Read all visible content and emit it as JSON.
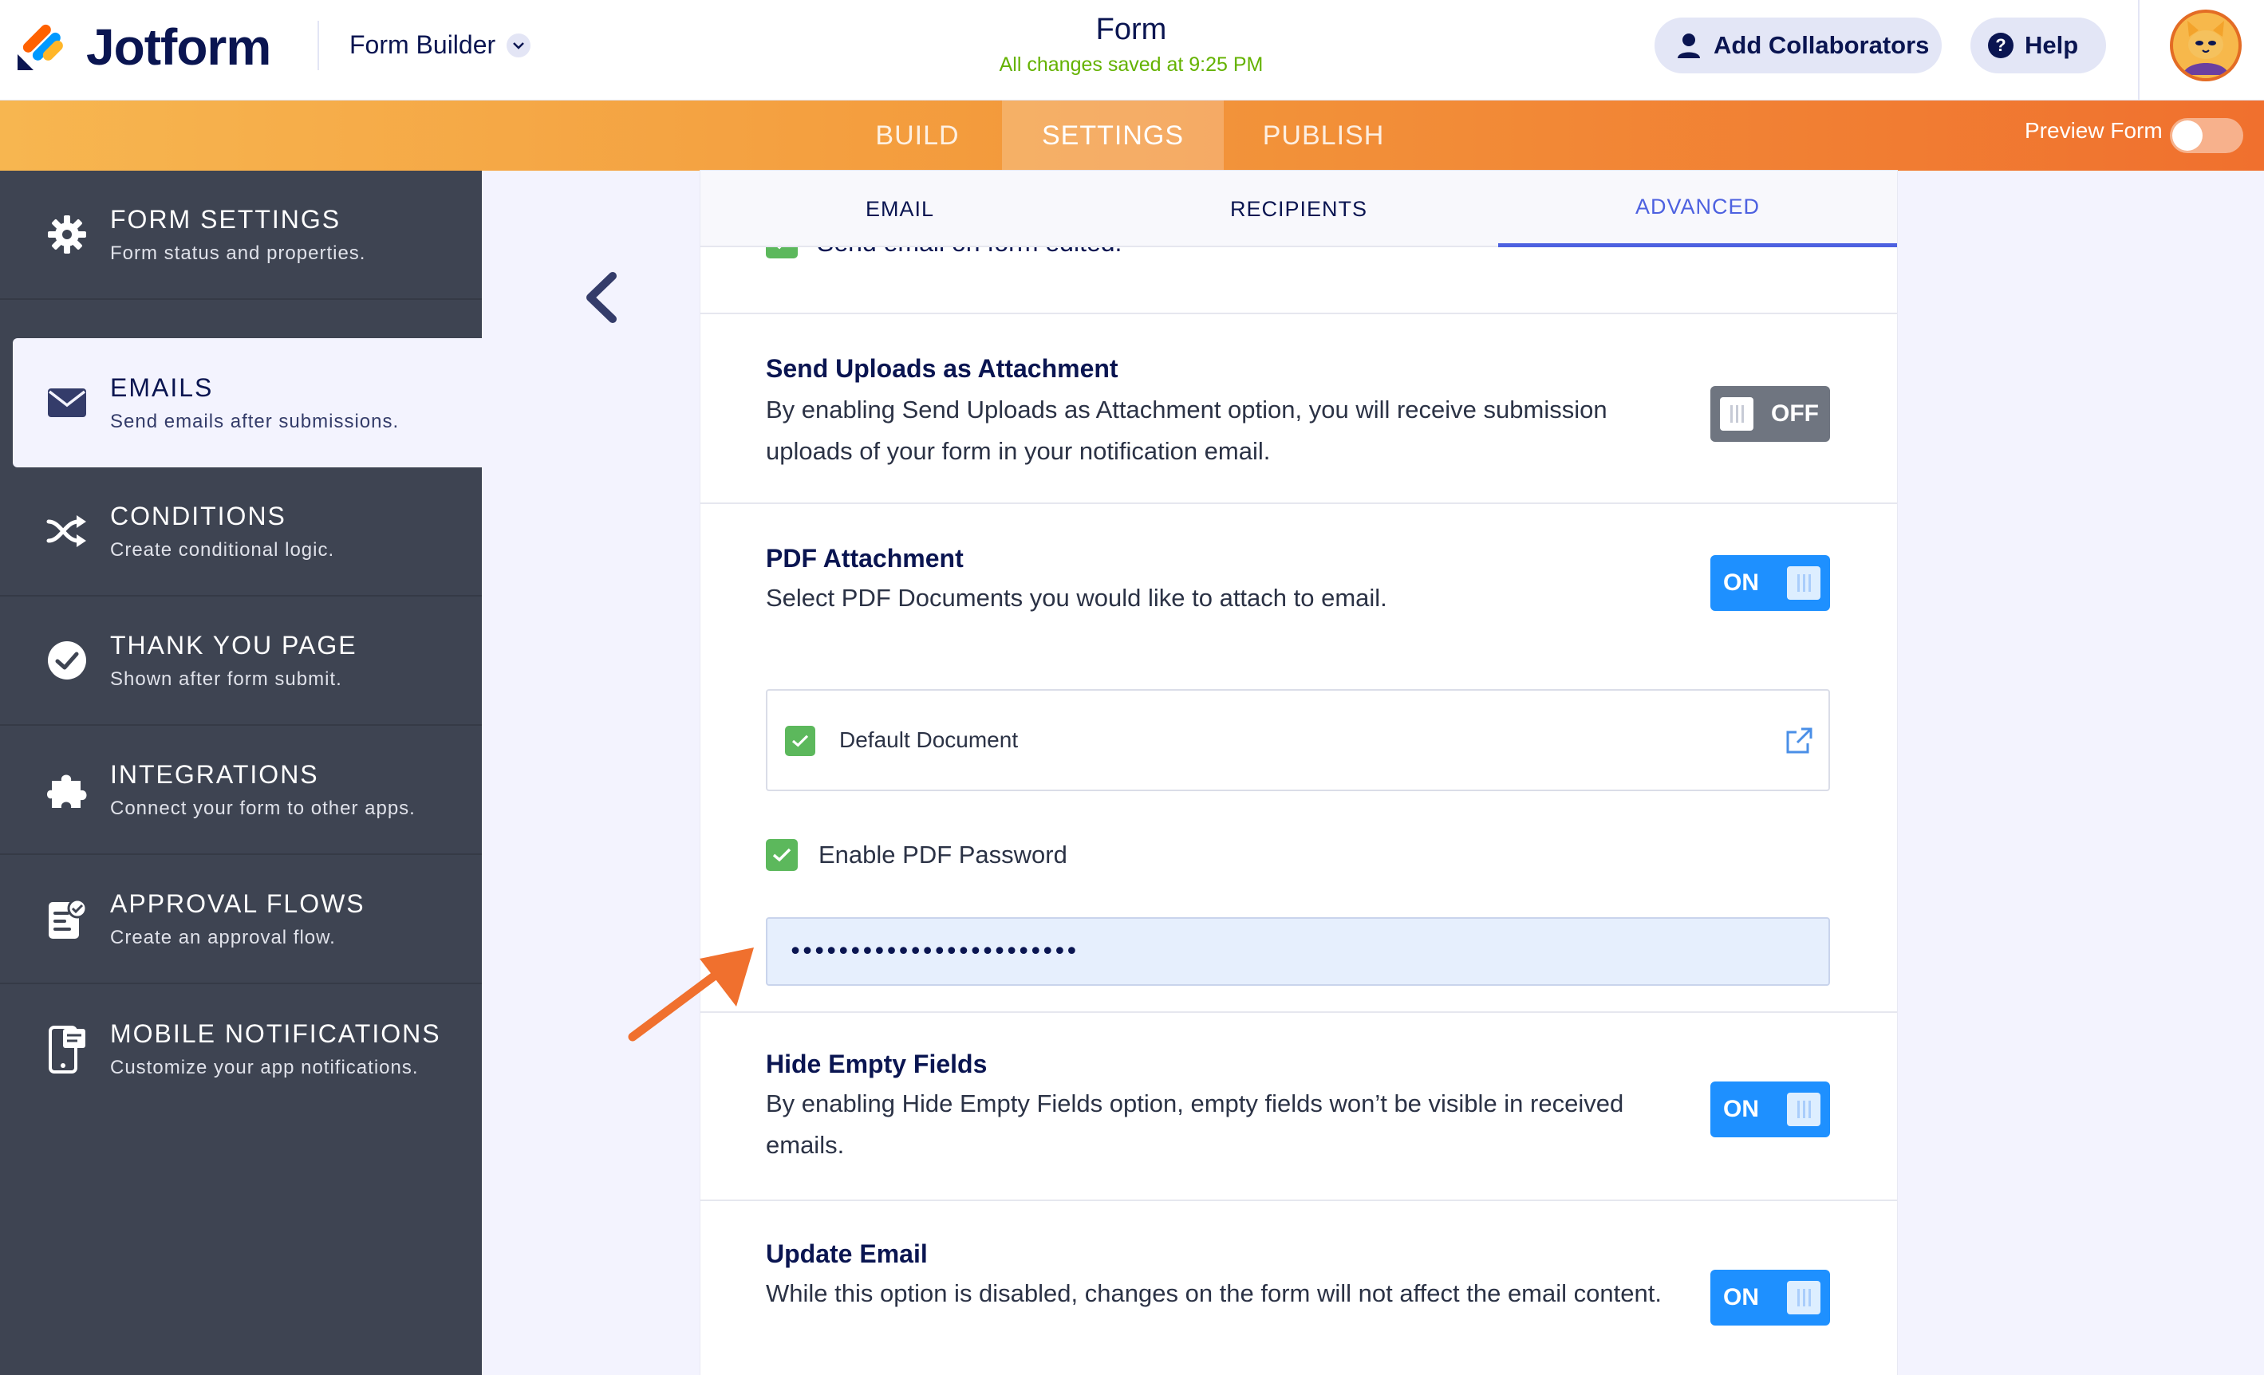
{
  "header": {
    "brand": "Jotform",
    "form_builder_label": "Form Builder",
    "form_title": "Form",
    "save_status": "All changes saved at 9:25 PM",
    "add_collaborators_label": "Add Collaborators",
    "help_label": "Help",
    "help_glyph": "?"
  },
  "nav": {
    "tabs": [
      {
        "label": "BUILD"
      },
      {
        "label": "SETTINGS"
      },
      {
        "label": "PUBLISH"
      }
    ],
    "active": "SETTINGS",
    "preview_label": "Preview Form"
  },
  "sidebar": {
    "items": [
      {
        "title": "FORM SETTINGS",
        "subtitle": "Form status and properties.",
        "icon": "gear-icon"
      },
      {
        "title": "EMAILS",
        "subtitle": "Send emails after submissions.",
        "icon": "envelope-icon"
      },
      {
        "title": "CONDITIONS",
        "subtitle": "Create conditional logic.",
        "icon": "shuffle-icon"
      },
      {
        "title": "THANK YOU PAGE",
        "subtitle": "Shown after form submit.",
        "icon": "check-circle-icon"
      },
      {
        "title": "INTEGRATIONS",
        "subtitle": "Connect your form to other apps.",
        "icon": "puzzle-icon"
      },
      {
        "title": "APPROVAL FLOWS",
        "subtitle": "Create an approval flow.",
        "icon": "approval-doc-icon"
      },
      {
        "title": "MOBILE NOTIFICATIONS",
        "subtitle": "Customize your app notifications.",
        "icon": "mobile-icon"
      }
    ],
    "active": "EMAILS"
  },
  "subtabs": {
    "items": [
      {
        "label": "EMAIL"
      },
      {
        "label": "RECIPIENTS"
      },
      {
        "label": "ADVANCED"
      }
    ],
    "active": "ADVANCED"
  },
  "settings": {
    "cut_row_label": "Send email on form edited.",
    "send_uploads": {
      "title": "Send Uploads as Attachment",
      "description": "By enabling Send Uploads as Attachment option, you will receive submission uploads of your form in your notification email.",
      "state": "OFF"
    },
    "pdf_attachment": {
      "title": "PDF Attachment",
      "description": "Select PDF Documents you would like to attach to email.",
      "state": "ON",
      "document_label": "Default Document",
      "enable_password_label": "Enable PDF Password",
      "password_value": "••••••••••••••••••••••••"
    },
    "hide_empty": {
      "title": "Hide Empty Fields",
      "description": "By enabling Hide Empty Fields option, empty fields won’t be visible in received emails.",
      "state": "ON"
    },
    "update_email": {
      "title": "Update Email",
      "description": "While this option is disabled, changes on the form will not affect the email content.",
      "state": "ON"
    }
  },
  "colors": {
    "accent_orange": "#f0702e",
    "accent_blue": "#1e90ff",
    "active_tab": "#4d61e0",
    "check_green": "#5cb85c",
    "sidebar_bg": "#3e4452"
  }
}
